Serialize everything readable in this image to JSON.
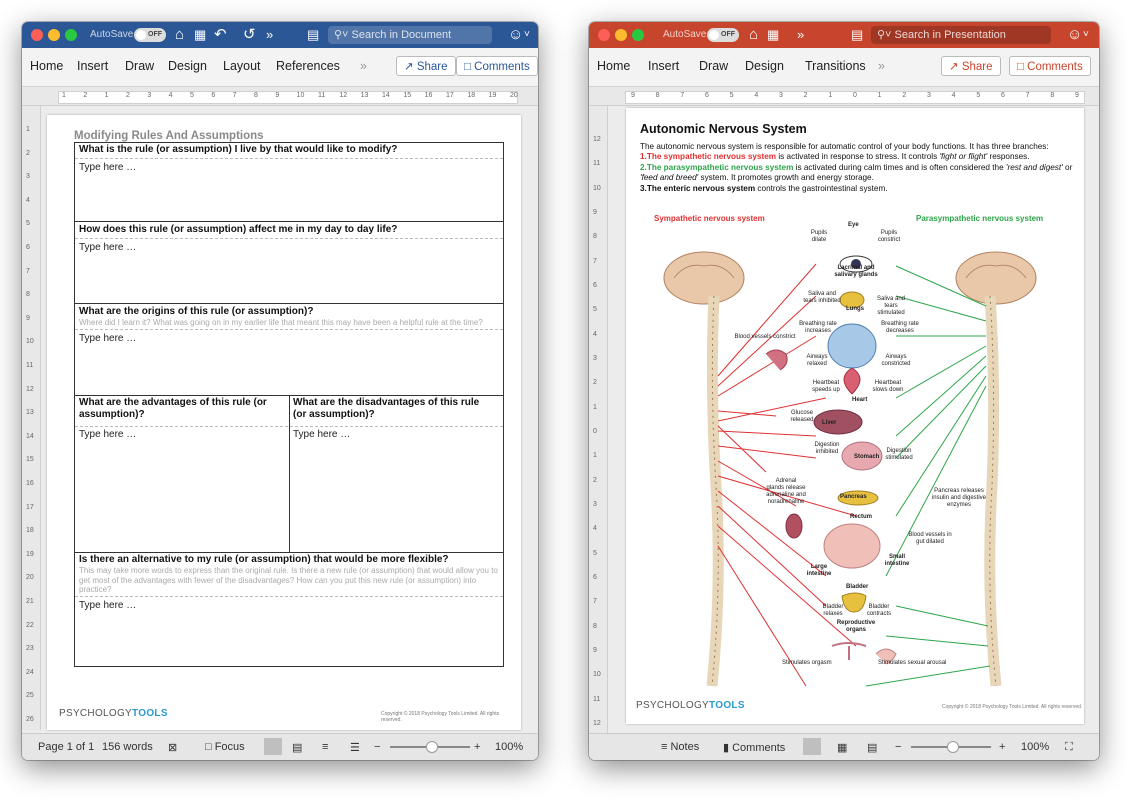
{
  "word": {
    "autosave_label": "AutoSave",
    "autosave_state": "OFF",
    "search_placeholder": "Search in Document",
    "tabs": [
      "Home",
      "Insert",
      "Draw",
      "Design",
      "Layout",
      "References"
    ],
    "share_label": "Share",
    "comments_label": "Comments",
    "ruler_numbers": [
      "1",
      "2",
      "1",
      "2",
      "3",
      "4",
      "5",
      "6",
      "7",
      "8",
      "9",
      "10",
      "11",
      "12",
      "13",
      "14",
      "15",
      "16",
      "17",
      "18",
      "19",
      "20"
    ],
    "vruler_numbers": [
      "1",
      "2",
      "3",
      "4",
      "5",
      "6",
      "7",
      "8",
      "9",
      "10",
      "11",
      "12",
      "13",
      "14",
      "15",
      "16",
      "17",
      "18",
      "19",
      "20",
      "21",
      "22",
      "23",
      "24",
      "25",
      "26"
    ],
    "document": {
      "title": "Modifying Rules And Assumptions",
      "q1": "What is the rule (or assumption) I live by that would like to modify?",
      "q2": "How does this rule (or assumption) affect me in my day to day life?",
      "q3": "What are the origins of this rule (or assumption)?",
      "q3_sub": "Where did I learn it? What was going on in my earlier life that meant this may have been a helpful rule at the time?",
      "q4a": "What are the advantages of this rule (or assumption)?",
      "q4b": "What are the disadvantages of this rule (or assumption)?",
      "q5": "Is there an alternative to my rule (or assumption) that would be more flexible?",
      "q5_sub": "This may take more words to express than the original rule. Is there a new rule (or assumption) that would allow you to get most of the advantages with fewer of the disadvantages? How can you put this new rule (or assumption) into practice?",
      "placeholder": "Type here …",
      "brand_a": "PSYCHOLOGY",
      "brand_b": "TOOLS",
      "copyright": "Copyright © 2018 Psychology Tools Limited. All rights reserved."
    },
    "status": {
      "page": "Page 1 of 1",
      "words": "156 words",
      "focus": "Focus",
      "zoom": "100%"
    }
  },
  "powerpoint": {
    "autosave_label": "AutoSave",
    "autosave_state": "OFF",
    "search_placeholder": "Search in Presentation",
    "tabs": [
      "Home",
      "Insert",
      "Draw",
      "Design",
      "Transitions"
    ],
    "share_label": "Share",
    "comments_label": "Comments",
    "ruler_numbers": [
      "9",
      "8",
      "7",
      "6",
      "5",
      "4",
      "3",
      "2",
      "1",
      "0",
      "1",
      "2",
      "3",
      "4",
      "5",
      "6",
      "7",
      "8",
      "9"
    ],
    "vruler_numbers": [
      "12",
      "11",
      "10",
      "9",
      "8",
      "7",
      "6",
      "5",
      "4",
      "3",
      "2",
      "1",
      "0",
      "1",
      "2",
      "3",
      "4",
      "5",
      "6",
      "7",
      "8",
      "9",
      "10",
      "11",
      "12"
    ],
    "slide": {
      "title": "Autonomic Nervous System",
      "intro": "The autonomic nervous system is responsible for automatic control of your body functions. It has three branches:",
      "b1_num": "1.",
      "b1_head": "The sympathetic nervous system",
      "b1_text": " is activated in response to stress. It controls ",
      "b1_em": "'fight or flight'",
      "b1_tail": " responses.",
      "b2_num": "2.",
      "b2_head": "The parasympathetic nervous system",
      "b2_text": " is activated during calm times and is often considered the ",
      "b2_em1": "'rest and digest'",
      "b2_mid": " or ",
      "b2_em2": "'feed and breed'",
      "b2_tail": " system. It promotes growth and energy storage.",
      "b3_num": "3.",
      "b3_head": "The enteric nervous system",
      "b3_tail": " controls the gastrointestinal system.",
      "sympathetic_label": "Sympathetic nervous system",
      "parasympathetic_label": "Parasympathetic nervous system",
      "organs": {
        "eye": "Eye",
        "pupils_dilate": "Pupils dilate",
        "pupils_constrict": "Pupils constrict",
        "glands": "Lacrimal and salivary glands",
        "saliva_inhibited": "Saliva and tears inhibited",
        "saliva_stimulated": "Saliva and tears stimulated",
        "lungs": "Lungs",
        "breathing_increases": "Breathing rate increases",
        "breathing_decreases": "Breathing rate decreases",
        "airways_relaxed": "Airways relaxed",
        "airways_constricted": "Airways constricted",
        "blood_vessels_constrict": "Blood vessels constrict",
        "heart": "Heart",
        "heartbeat_up": "Heartbeat speeds up",
        "heartbeat_down": "Heartbeat slows down",
        "liver": "Liver",
        "glucose": "Glucose released",
        "stomach": "Stomach",
        "digestion_inhibited": "Digestion inhibited",
        "digestion_stimulated": "Digestion stimulated",
        "pancreas": "Pancreas",
        "pancreas_releases": "Pancreas releases insulin and digestive enzymes",
        "adrenal": "Adrenal glands release adrenaline and noradrenaline",
        "rectum": "Rectum",
        "vessels_dilated": "Blood vessels in gut dilated",
        "small_intestine": "Small intestine",
        "large_intestine": "Large intestine",
        "bladder": "Bladder",
        "bladder_relaxes": "Bladder relaxes",
        "bladder_contracts": "Bladder contracts",
        "reproductive": "Reproductive organs",
        "stim_orgasm": "Stimulates orgasm",
        "stim_arousal": "Stimulates sexual arousal"
      },
      "brand_a": "PSYCHOLOGY",
      "brand_b": "TOOLS",
      "copyright": "Copyright © 2018 Psychology Tools Limited. All rights reserved."
    },
    "status": {
      "notes": "Notes",
      "comments": "Comments",
      "zoom": "100%"
    }
  },
  "colors": {
    "word_blue": "#2b5797",
    "ppt_orange": "#c8452d",
    "sympathetic_red": "#e03030",
    "parasympathetic_green": "#2ea54a"
  }
}
